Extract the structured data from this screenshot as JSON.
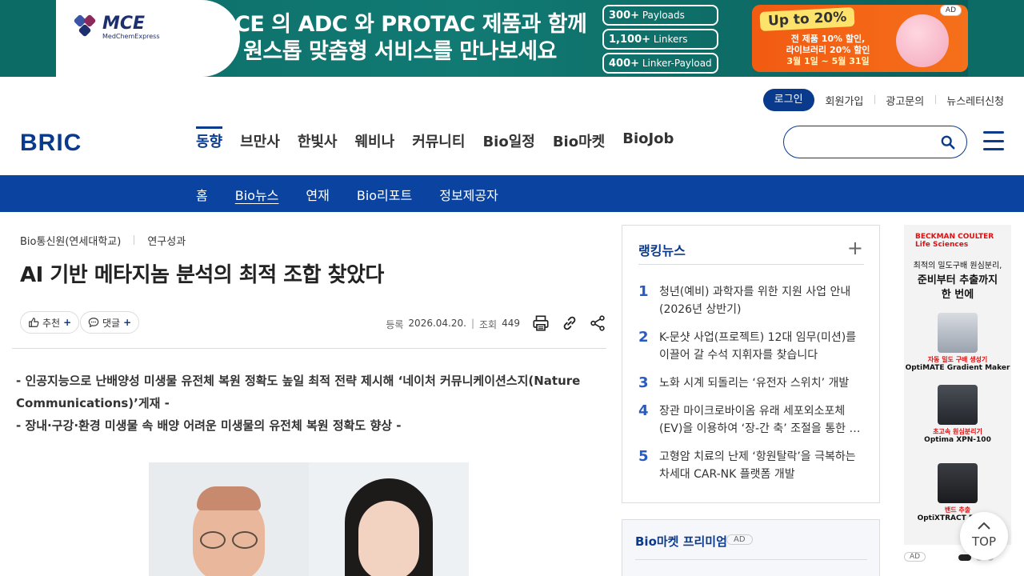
{
  "banner": {
    "brand": "MCE",
    "brand_sub": "MedChemExpress",
    "headline_line1": "MCE 의 ADC 와 PROTAC 제품과 함께",
    "headline_line2": "원스톱 맞춤형 서비스를 만나보세요",
    "pills": [
      {
        "bold": "300+",
        "rest": " Payloads"
      },
      {
        "bold": "1,100+",
        "rest": " Linkers"
      },
      {
        "bold": "400+",
        "rest": " Linker-Payload"
      }
    ],
    "promo_badge": "Up to 20%",
    "promo_line1": "전 제품 10% 할인,",
    "promo_line2": "라이브러리 20% 할인",
    "promo_date": "3월 1일 ~ 5월 31일",
    "ad_label": "AD"
  },
  "util_nav": {
    "login": "로그인",
    "links": [
      "회원가입",
      "광고문의",
      "뉴스레터신청"
    ]
  },
  "logo": "BRIC",
  "main_nav": [
    "동향",
    "브만사",
    "한빛사",
    "웨비나",
    "커뮤니티",
    "Bio일정",
    "Bio마켓",
    "BioJob"
  ],
  "search": {
    "placeholder": ""
  },
  "sub_nav": [
    "홈",
    "Bio뉴스",
    "연재",
    "Bio리포트",
    "정보제공자"
  ],
  "article": {
    "source": "Bio통신원(연세대학교)",
    "category": "연구성과",
    "title": "AI 기반 메타지놈 분석의 최적 조합 찾았다",
    "recommend_label": "추천",
    "comment_label": "댓글",
    "plus": "+",
    "date_label": "등록",
    "date": "2026.04.20.",
    "views_label": "조회",
    "views": "449",
    "summary_1": "- 인공지능으로 난배양성 미생물 유전체 복원 정확도 높일 최적 전략 제시해 ‘네이처 커뮤니케이션스지(Nature Communications)’게재 -",
    "summary_2": "- 장내·구강·환경 미생물 속 배양 어려운 미생물의 유전체 복원 정확도 향상 -"
  },
  "ranking": {
    "title": "랭킹뉴스",
    "items": [
      {
        "num": "1",
        "text": "청년(예비) 과학자를 위한 지원 사업 안내 (2026년 상반기)"
      },
      {
        "num": "2",
        "text": "K-문샷 사업(프로젝트) 12대 임무(미션)를 이끌어 갈 수석 지휘자를 찾습니다"
      },
      {
        "num": "3",
        "text": "노화 시계 되돌리는 ‘유전자 스위치’ 개발"
      },
      {
        "num": "4",
        "text": "장관 마이크로바이옴 유래 세포외소포체 (EV)을 이용하여 ‘장-간 축’ 조절을 통한 …"
      },
      {
        "num": "5",
        "text": "고형암 치료의 난제 ‘항원탈락’을 극복하는 차세대 CAR-NK 플랫폼 개발"
      }
    ]
  },
  "premium": {
    "title": "Bio마켓 프리미엄",
    "ad": "AD"
  },
  "side_ad": {
    "brand": "BECKMAN COULTER Life Sciences",
    "line1": "최적의 밀도구배 원심분리,",
    "line2": "준비부터 추출까지",
    "line3": "한 번에",
    "products": [
      {
        "red": "자동 밀도 구배 생성기",
        "name": "OptiMATE Gradient Maker"
      },
      {
        "red": "초고속 원심분리기",
        "name": "Optima XPN-100"
      },
      {
        "red": "밴드 추출",
        "name": "OptiXTRACT Recove"
      }
    ],
    "ad_label": "AD"
  },
  "top_button": "TOP",
  "colors": {
    "brand": "#0a3a8c",
    "subnav": "#0a44a0",
    "rank_num": "#2a5bbf"
  }
}
